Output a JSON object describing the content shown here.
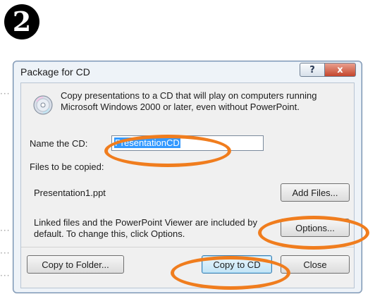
{
  "step_number": "2",
  "dialog": {
    "title": "Package for CD",
    "help_button": "?",
    "close_button": "x",
    "description": "Copy presentations to a CD that will play on computers running Microsoft Windows 2000 or later, even without PowerPoint.",
    "name_label": "Name the CD:",
    "name_value": "PresentationCD",
    "files_label": "Files to be copied:",
    "files": [
      "Presentation1.ppt"
    ],
    "add_files_button": "Add Files...",
    "linked_text": "Linked files and the PowerPoint Viewer are included by default. To change this, click Options.",
    "options_button": "Options...",
    "copy_to_folder_button": "Copy to Folder...",
    "copy_to_cd_button": "Copy to CD",
    "close_dialog_button": "Close"
  },
  "colors": {
    "highlight": "#f07d1e",
    "selection": "#3399ff"
  },
  "icons": {
    "cd": "cd-icon"
  }
}
